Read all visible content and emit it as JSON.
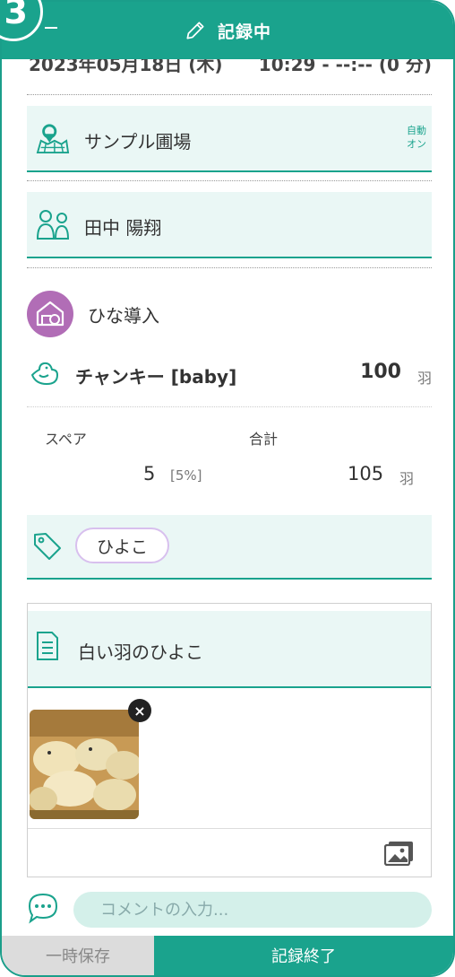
{
  "step": "3",
  "header": {
    "title": "記録中"
  },
  "datetime": {
    "date": "2023年05月18日 (木)",
    "time": "10:29 - --:-- (0 分)"
  },
  "farm": {
    "name": "サンプル圃場",
    "auto_line1": "自動",
    "auto_line2": "オン"
  },
  "person": {
    "name": "田中 陽翔"
  },
  "event": {
    "name": "ひな導入"
  },
  "breed": {
    "name": "チャンキー [baby]",
    "count": "100",
    "unit": "羽"
  },
  "spare": {
    "label": "スペア",
    "value": "5",
    "percent": "[5%]"
  },
  "total": {
    "label": "合計",
    "value": "105",
    "unit": "羽"
  },
  "tag": {
    "label": "ひよこ"
  },
  "memo": {
    "text": "白い羽のひよこ",
    "remove_label": "×"
  },
  "comment": {
    "placeholder": "コメントの入力..."
  },
  "footer": {
    "save_label": "一時保存",
    "end_label": "記録終了"
  },
  "colors": {
    "accent": "#1aa38d",
    "mint": "#eaf7f5",
    "event": "#b16db6",
    "tag_border": "#d8c0ee"
  },
  "icons": [
    "pencil-icon",
    "map-pin-icon",
    "people-icon",
    "barn-icon",
    "bird-icon",
    "tag-icon",
    "document-icon",
    "close-icon",
    "image-icon",
    "chat-icon"
  ]
}
